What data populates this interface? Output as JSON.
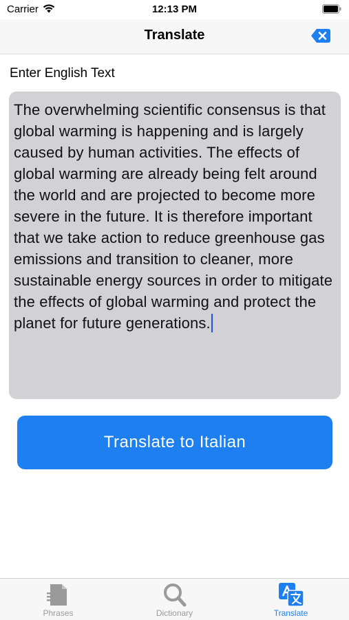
{
  "status_bar": {
    "carrier": "Carrier",
    "time": "12:13 PM"
  },
  "nav": {
    "title": "Translate",
    "clear_icon": "backspace-icon"
  },
  "input": {
    "label": "Enter English Text",
    "text": "The overwhelming scientific consensus is that global warming is happening and is largely caused by human activities. The effects of global warming are already being felt around the world and are projected to become more severe in the future. It is therefore important that we take action to reduce greenhouse gas emissions and transition to cleaner, more sustainable energy sources in order to mitigate the effects of global warming and protect the planet for future generations."
  },
  "action": {
    "translate_label": "Translate to Italian"
  },
  "tabs": [
    {
      "label": "Phrases",
      "icon": "document-icon",
      "active": false
    },
    {
      "label": "Dictionary",
      "icon": "search-icon",
      "active": false
    },
    {
      "label": "Translate",
      "icon": "translate-icon",
      "active": true
    }
  ],
  "colors": {
    "accent": "#1d7ff0",
    "text_area_bg": "#d1d1d6",
    "inactive_tab": "#9a9a9a"
  }
}
